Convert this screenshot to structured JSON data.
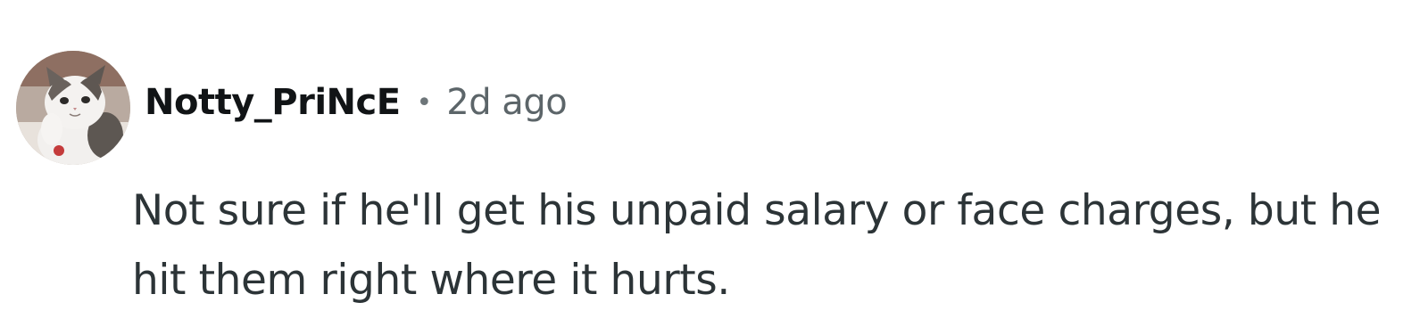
{
  "comment": {
    "author": {
      "username": "Notty_PriNcE",
      "avatar_icon": "cat-avatar-icon"
    },
    "separator": "•",
    "timestamp": "2d ago",
    "body": "Not sure if he'll get his unpaid salary or face charges, but he hit them right where it hurts."
  },
  "colors": {
    "username": "#111416",
    "timestamp": "#5c6569",
    "body_text": "#2c3437",
    "background": "#ffffff"
  }
}
